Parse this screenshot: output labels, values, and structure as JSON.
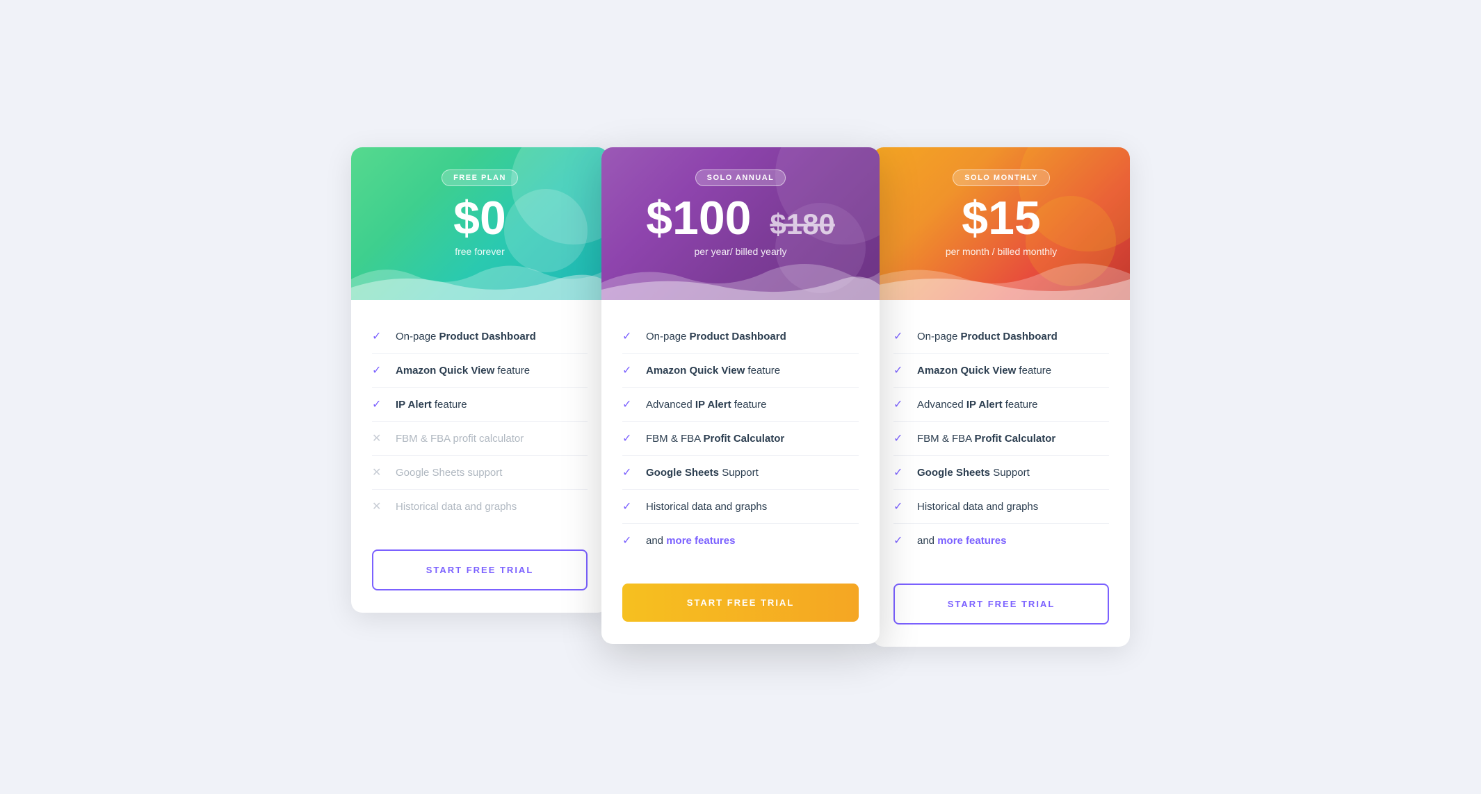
{
  "plans": [
    {
      "id": "free",
      "badge": "FREE PLAN",
      "headerClass": "green",
      "price": "$0",
      "priceStrikethrough": null,
      "subtitle": "free forever",
      "ctaLabel": "START FREE TRIAL",
      "ctaStyle": "outline",
      "features": [
        {
          "text": "On-page ",
          "bold": "Product Dashboard",
          "enabled": true
        },
        {
          "text": "",
          "bold": "Amazon Quick View",
          "suffix": " feature",
          "enabled": true
        },
        {
          "text": "",
          "bold": "IP Alert",
          "suffix": " feature",
          "enabled": true
        },
        {
          "text": "FBM & FBA profit calculator",
          "bold": null,
          "enabled": false
        },
        {
          "text": "Google Sheets support",
          "bold": null,
          "enabled": false
        },
        {
          "text": "Historical data and graphs",
          "bold": null,
          "enabled": false
        }
      ]
    },
    {
      "id": "solo-annual",
      "badge": "SOLO ANNUAL",
      "headerClass": "purple",
      "price": "$100",
      "priceStrikethrough": "$180",
      "subtitle": "per year/ billed yearly",
      "ctaLabel": "START FREE TRIAL",
      "ctaStyle": "filled-yellow",
      "features": [
        {
          "text": "On-page ",
          "bold": "Product Dashboard",
          "enabled": true
        },
        {
          "text": "",
          "bold": "Amazon Quick View",
          "suffix": " feature",
          "enabled": true
        },
        {
          "text": "Advanced ",
          "bold": "IP Alert",
          "suffix": " feature",
          "enabled": true
        },
        {
          "text": "FBM & FBA ",
          "bold": "Profit Calculator",
          "enabled": true
        },
        {
          "text": "",
          "bold": "Google Sheets",
          "suffix": " Support",
          "enabled": true
        },
        {
          "text": "Historical data and graphs",
          "bold": null,
          "enabled": true
        },
        {
          "text": "and ",
          "bold": null,
          "more": true,
          "moreText": "more features",
          "enabled": true
        }
      ]
    },
    {
      "id": "solo-monthly",
      "badge": "SOLO MONTHLY",
      "headerClass": "orange",
      "price": "$15",
      "priceStrikethrough": null,
      "subtitle": "per month / billed monthly",
      "ctaLabel": "START FREE TRIAL",
      "ctaStyle": "outline",
      "features": [
        {
          "text": "On-page ",
          "bold": "Product Dashboard",
          "enabled": true
        },
        {
          "text": "",
          "bold": "Amazon Quick View",
          "suffix": " feature",
          "enabled": true
        },
        {
          "text": "Advanced ",
          "bold": "IP Alert",
          "suffix": " feature",
          "enabled": true
        },
        {
          "text": "FBM & FBA ",
          "bold": "Profit Calculator",
          "enabled": true
        },
        {
          "text": "",
          "bold": "Google Sheets",
          "suffix": " Support",
          "enabled": true
        },
        {
          "text": "Historical data and graphs",
          "bold": null,
          "enabled": true
        },
        {
          "text": "and ",
          "bold": null,
          "more": true,
          "moreText": "more features",
          "enabled": true
        }
      ]
    }
  ]
}
